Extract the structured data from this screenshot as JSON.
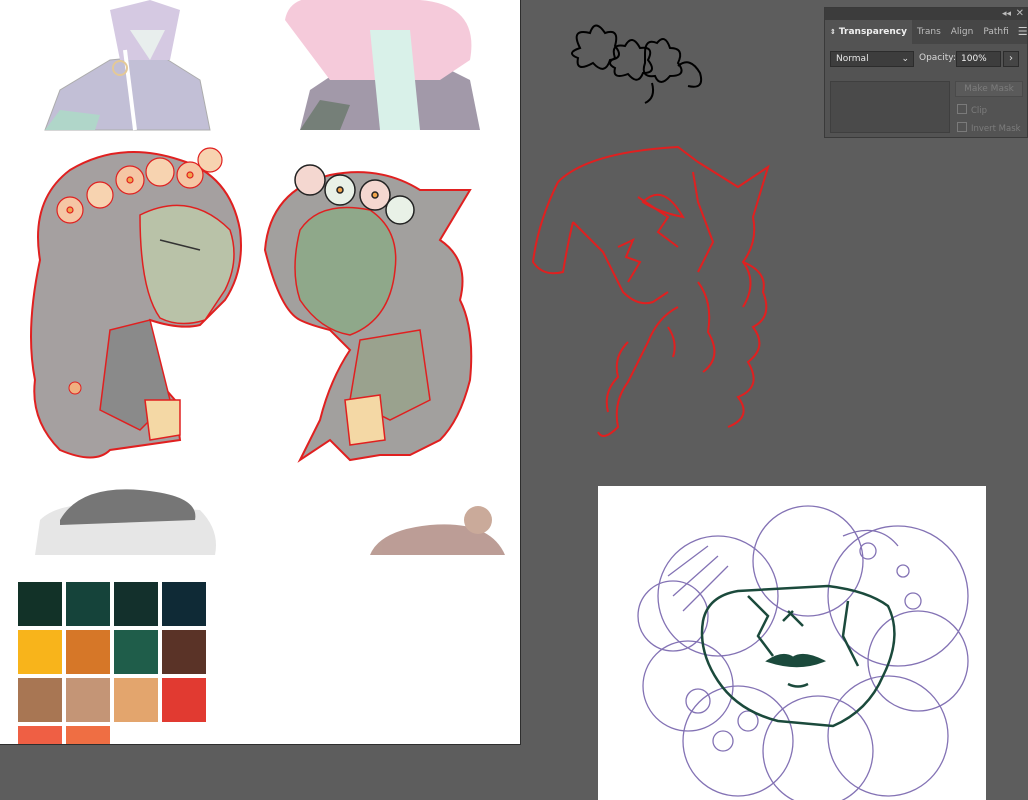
{
  "panel": {
    "tabs": [
      "Transparency",
      "Trans",
      "Align",
      "Pathfi"
    ],
    "blend_mode": "Normal",
    "opacity_label": "Opacity:",
    "opacity_value": "100%",
    "make_mask_label": "Make Mask",
    "clip_label": "Clip",
    "invert_mask_label": "Invert Mask"
  },
  "palette": [
    "#123228",
    "#15433a",
    "#13302c",
    "#0f2a36",
    "#f8b41b",
    "#d67728",
    "#1f5d4a",
    "#5a3327",
    "#a87653",
    "#c49576",
    "#e3a56d",
    "#e13a31",
    "#ef5f44",
    "#ef6e43"
  ],
  "colors": {
    "canvas": "#5d5d5d",
    "sketch_red": "#e02020",
    "sketch_purple": "#6e5aa8",
    "ink_green": "#1b4a3c"
  }
}
